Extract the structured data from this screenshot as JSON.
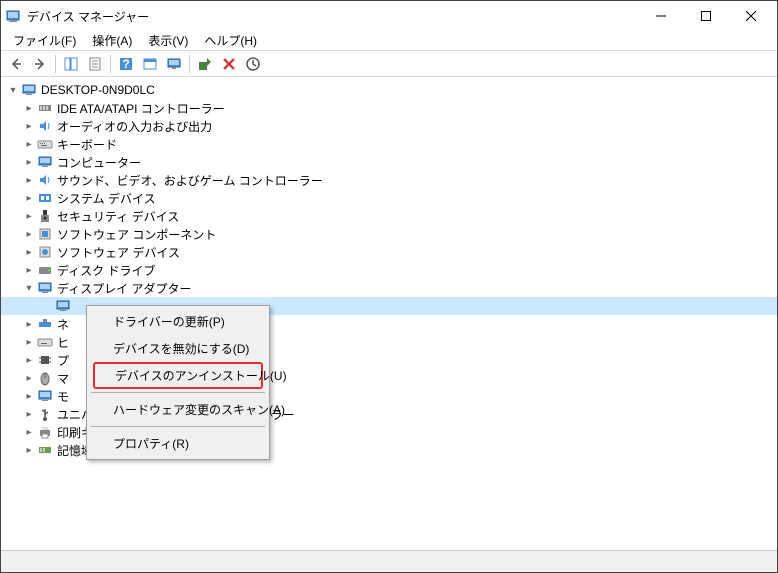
{
  "window": {
    "title": "デバイス マネージャー"
  },
  "menu": {
    "file": "ファイル(F)",
    "action": "操作(A)",
    "view": "表示(V)",
    "help": "ヘルプ(H)"
  },
  "tree": {
    "root": "DESKTOP-0N9D0LC",
    "items": [
      "IDE ATA/ATAPI コントローラー",
      "オーディオの入力および出力",
      "キーボード",
      "コンピューター",
      "サウンド、ビデオ、およびゲーム コントローラー",
      "システム デバイス",
      "セキュリティ デバイス",
      "ソフトウェア コンポーネント",
      "ソフトウェア デバイス",
      "ディスク ドライブ",
      "ディスプレイ アダプター",
      "ネ",
      "ヒ",
      "プ",
      "マ",
      "モ",
      "ユニバーサル シリアル バス コントローラー",
      "印刷キュー",
      "記憶域コントローラー"
    ],
    "expanded_child": ""
  },
  "context_menu": {
    "update_driver": "ドライバーの更新(P)",
    "disable_device": "デバイスを無効にする(D)",
    "uninstall_device": "デバイスのアンインストール(U)",
    "scan_hardware": "ハードウェア変更のスキャン(A)",
    "properties": "プロパティ(R)"
  }
}
